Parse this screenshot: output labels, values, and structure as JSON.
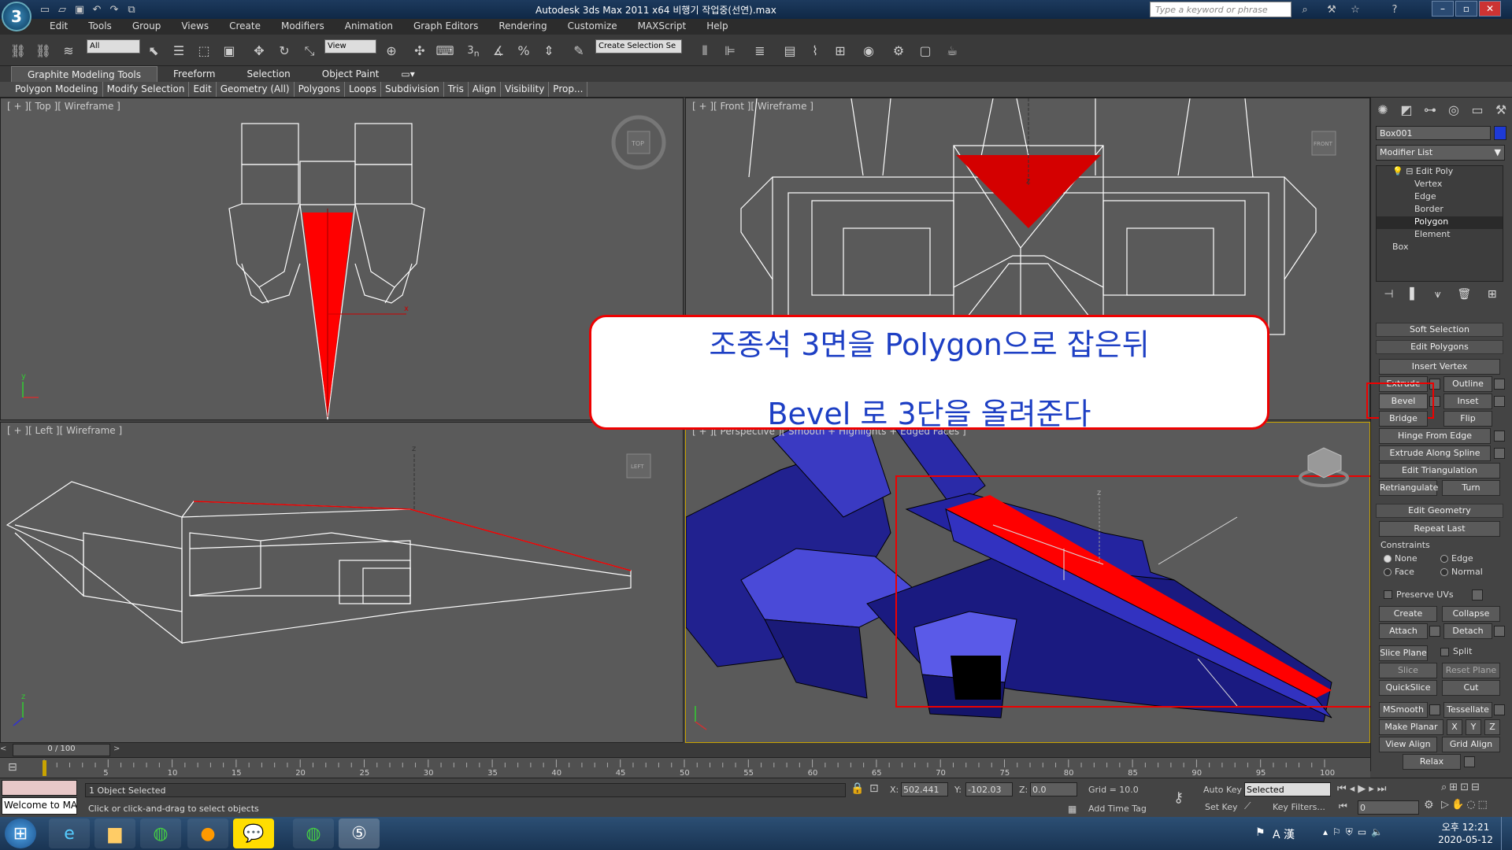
{
  "app": {
    "title": "Autodesk 3ds Max  2011 x64     비행기 작업중(선연).max",
    "logo": "3",
    "search_placeholder": "Type a keyword or phrase"
  },
  "menu": [
    "Edit",
    "Tools",
    "Group",
    "Views",
    "Create",
    "Modifiers",
    "Animation",
    "Graph Editors",
    "Rendering",
    "Customize",
    "MAXScript",
    "Help"
  ],
  "toolbar": {
    "filter": "All",
    "refcoord": "View",
    "selection_set": "Create Selection Se",
    "snap_label": "3",
    "snap_suffix": "n"
  },
  "ribbon": {
    "tabs": [
      "Graphite Modeling Tools",
      "Freeform",
      "Selection",
      "Object Paint"
    ],
    "panels": [
      "Polygon Modeling",
      "Modify Selection",
      "Edit",
      "Geometry (All)",
      "Polygons",
      "Loops",
      "Subdivision",
      "Tris",
      "Align",
      "Visibility",
      "Prop..."
    ]
  },
  "viewports": {
    "top": "[ + ][ Top ][ Wireframe ]",
    "front": "[ + ][ Front ][ Wireframe ]",
    "left": "[ + ][ Left ][ Wireframe ]",
    "perspective": "[ + ][ Perspective ][ Smooth + Highlights + Edged Faces ]",
    "cube_top": "TOP",
    "cube_front": "FRONT",
    "cube_left": "LEFT",
    "axis_x": "x",
    "axis_y": "y",
    "axis_z": "z"
  },
  "annotation": {
    "line1": "조종석 3면을 Polygon으로 잡은뒤",
    "line2": "Bevel 로 3단을 올려준다"
  },
  "command_panel": {
    "object_name": "Box001",
    "modifier_list": "Modifier List",
    "stack": {
      "edit_poly": "Edit Poly",
      "vertex": "Vertex",
      "edge": "Edge",
      "border": "Border",
      "polygon": "Polygon",
      "element": "Element",
      "box": "Box"
    },
    "soft_selection": "Soft Selection",
    "edit_polygons": "Edit Polygons",
    "insert_vertex": "Insert Vertex",
    "extrude": "Extrude",
    "outline": "Outline",
    "bevel": "Bevel",
    "inset": "Inset",
    "bridge": "Bridge",
    "flip": "Flip",
    "hinge": "Hinge From Edge",
    "extrude_spline": "Extrude Along Spline",
    "edit_triangulation": "Edit Triangulation",
    "retriangulate": "Retriangulate",
    "turn": "Turn",
    "edit_geometry": "Edit Geometry",
    "repeat_last": "Repeat Last",
    "constraints": "Constraints",
    "none": "None",
    "c_edge": "Edge",
    "face": "Face",
    "normal": "Normal",
    "preserve_uvs": "Preserve UVs",
    "create": "Create",
    "collapse": "Collapse",
    "attach": "Attach",
    "detach": "Detach",
    "slice_plane": "Slice Plane",
    "split": "Split",
    "slice": "Slice",
    "reset_plane": "Reset Plane",
    "quickslice": "QuickSlice",
    "cut": "Cut",
    "msmooth": "MSmooth",
    "tessellate": "Tessellate",
    "make_planar": "Make Planar",
    "x": "X",
    "y": "Y",
    "z": "Z",
    "view_align": "View Align",
    "grid_align": "Grid Align",
    "relax": "Relax"
  },
  "timeline": {
    "frame": "0 / 100",
    "ticks": [
      "5",
      "10",
      "15",
      "20",
      "25",
      "30",
      "35",
      "40",
      "45",
      "50",
      "55",
      "60",
      "65",
      "70",
      "75",
      "80",
      "85",
      "90",
      "95",
      "100"
    ]
  },
  "status": {
    "welcome": "Welcome to MA",
    "selected": "1 Object Selected",
    "prompt": "Click or click-and-drag to select objects",
    "x_label": "X:",
    "x": "502.441",
    "y_label": "Y:",
    "y": "-102.03",
    "z_label": "Z:",
    "z": "0.0",
    "grid": "Grid = 10.0",
    "add_time_tag": "Add Time Tag",
    "auto_key": "Auto Key",
    "set_key": "Set Key",
    "key_mode": "Selected",
    "key_filters": "Key Filters...",
    "frame_field": "0"
  },
  "taskbar": {
    "time": "오후 12:21",
    "date": "2020-05-12",
    "ime": "A 漢"
  }
}
